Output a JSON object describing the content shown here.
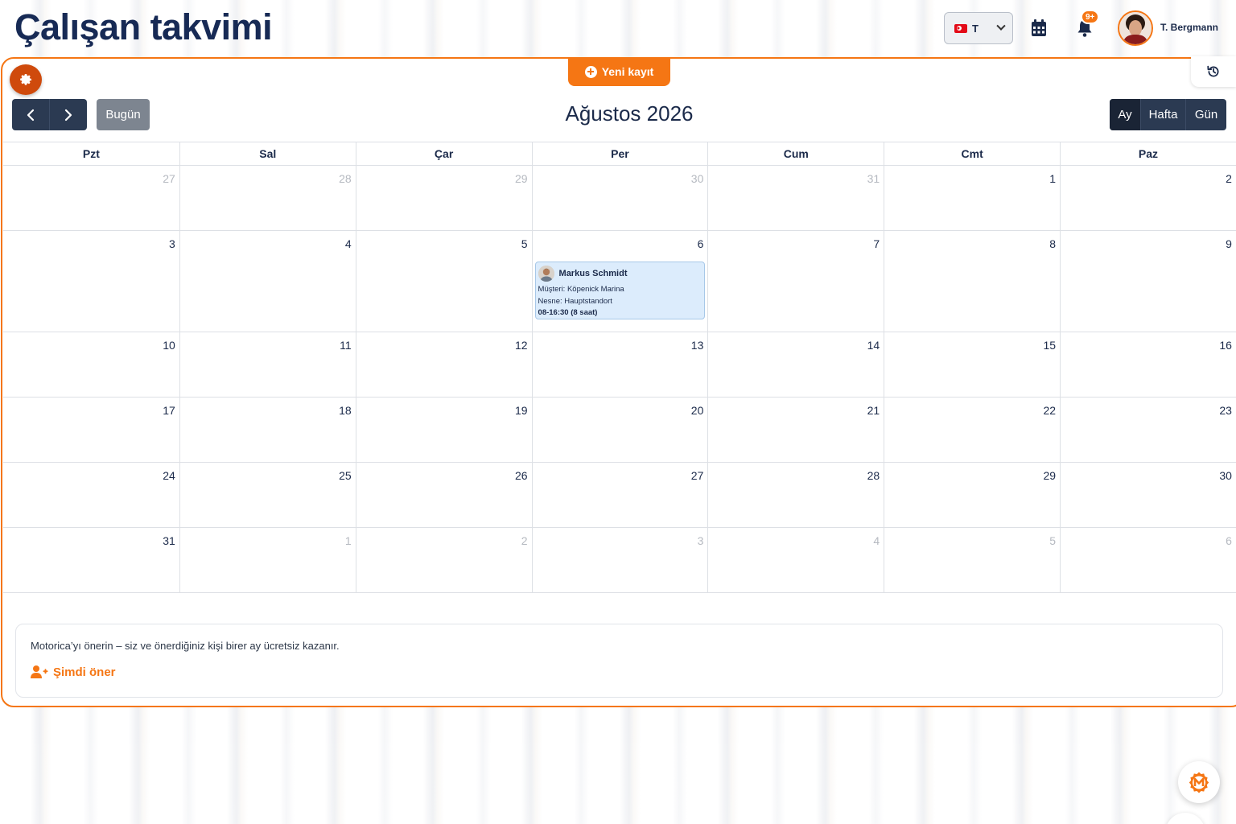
{
  "header": {
    "title": "Çalışan takvimi",
    "language": {
      "selected": "T",
      "flag_icon": "turkey-flag-icon"
    },
    "calendar_icon": "calendar-icon",
    "notification_icon": "bell-icon",
    "notification_count": "9+",
    "user_name": "T. Bergmann"
  },
  "toolbar": {
    "new_entry_label": "Yeni kayıt",
    "today_label": "Bugün",
    "month_title": "Ağustos 2026",
    "views": [
      {
        "label": "Ay",
        "active": true
      },
      {
        "label": "Hafta",
        "active": false
      },
      {
        "label": "Gün",
        "active": false
      }
    ]
  },
  "calendar": {
    "weekdays": [
      "Pzt",
      "Sal",
      "Çar",
      "Per",
      "Cum",
      "Cmt",
      "Paz"
    ],
    "weeks": [
      [
        {
          "d": "27",
          "m": true
        },
        {
          "d": "28",
          "m": true
        },
        {
          "d": "29",
          "m": true
        },
        {
          "d": "30",
          "m": true
        },
        {
          "d": "31",
          "m": true
        },
        {
          "d": "1"
        },
        {
          "d": "2"
        }
      ],
      [
        {
          "d": "3"
        },
        {
          "d": "4"
        },
        {
          "d": "5"
        },
        {
          "d": "6",
          "event": 0
        },
        {
          "d": "7"
        },
        {
          "d": "8"
        },
        {
          "d": "9"
        }
      ],
      [
        {
          "d": "10"
        },
        {
          "d": "11"
        },
        {
          "d": "12"
        },
        {
          "d": "13"
        },
        {
          "d": "14"
        },
        {
          "d": "15"
        },
        {
          "d": "16"
        }
      ],
      [
        {
          "d": "17"
        },
        {
          "d": "18"
        },
        {
          "d": "19"
        },
        {
          "d": "20"
        },
        {
          "d": "21"
        },
        {
          "d": "22"
        },
        {
          "d": "23"
        }
      ],
      [
        {
          "d": "24"
        },
        {
          "d": "25"
        },
        {
          "d": "26"
        },
        {
          "d": "27"
        },
        {
          "d": "28"
        },
        {
          "d": "29"
        },
        {
          "d": "30"
        }
      ],
      [
        {
          "d": "31"
        },
        {
          "d": "1",
          "m": true
        },
        {
          "d": "2",
          "m": true
        },
        {
          "d": "3",
          "m": true
        },
        {
          "d": "4",
          "m": true
        },
        {
          "d": "5",
          "m": true
        },
        {
          "d": "6",
          "m": true
        }
      ]
    ],
    "events": [
      {
        "name": "Markus Schmidt",
        "customer": "Müşteri: Köpenick Marina",
        "object": "Nesne: Hauptstandort",
        "time": "08-16:30 (8 saat)"
      }
    ]
  },
  "referral": {
    "text": "Motorica’yı önerin – siz ve önerdiğiniz kişi birer ay ücretsiz kazanır.",
    "link_label": "Şimdi öner"
  },
  "colors": {
    "accent": "#f57614",
    "settings": "#cf4a0c",
    "navy": "#172a55",
    "event_bg": "#dcecfc"
  }
}
